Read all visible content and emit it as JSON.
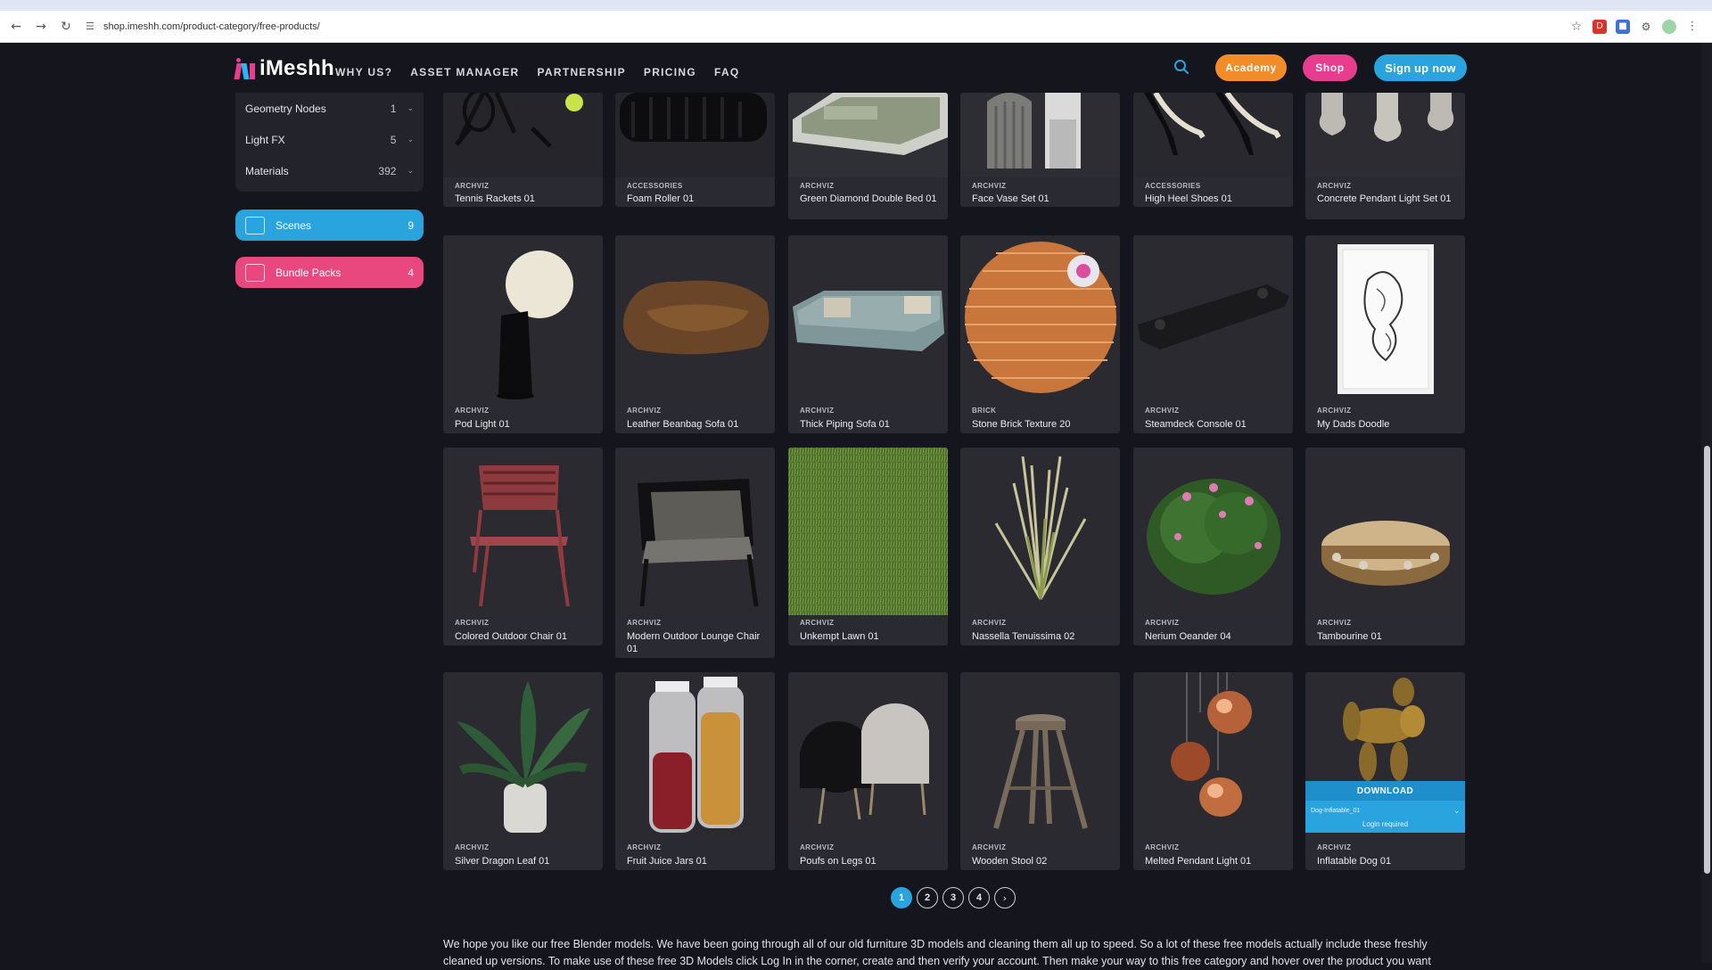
{
  "browser": {
    "url": "shop.imeshh.com/product-category/free-products/"
  },
  "header": {
    "logo_text": "iMeshh",
    "nav": [
      "WHY US?",
      "ASSET MANAGER",
      "PARTNERSHIP",
      "PRICING",
      "FAQ"
    ],
    "academy_label": "Academy",
    "shop_label": "Shop",
    "signup_label": "Sign up now"
  },
  "sidebar": {
    "categories": [
      {
        "label": "Geometry Nodes",
        "count": "1"
      },
      {
        "label": "Light FX",
        "count": "5"
      },
      {
        "label": "Materials",
        "count": "392"
      }
    ],
    "scenes": {
      "label": "Scenes",
      "count": "9"
    },
    "bundles": {
      "label": "Bundle Packs",
      "count": "4"
    }
  },
  "products": [
    {
      "cat": "ARCHVIZ",
      "name": "Tennis Rackets 01"
    },
    {
      "cat": "ACCESSORIES",
      "name": "Foam Roller 01"
    },
    {
      "cat": "ARCHVIZ",
      "name": "Green Diamond Double Bed 01"
    },
    {
      "cat": "ARCHVIZ",
      "name": "Face Vase Set 01"
    },
    {
      "cat": "ACCESSORIES",
      "name": "High Heel Shoes 01"
    },
    {
      "cat": "ARCHVIZ",
      "name": "Concrete Pendant Light Set 01"
    },
    {
      "cat": "ARCHVIZ",
      "name": "Pod Light 01"
    },
    {
      "cat": "ARCHVIZ",
      "name": "Leather Beanbag Sofa 01"
    },
    {
      "cat": "ARCHVIZ",
      "name": "Thick Piping Sofa 01"
    },
    {
      "cat": "BRICK",
      "name": "Stone Brick Texture 20"
    },
    {
      "cat": "ARCHVIZ",
      "name": "Steamdeck Console 01"
    },
    {
      "cat": "ARCHVIZ",
      "name": "My Dads Doodle"
    },
    {
      "cat": "ARCHVIZ",
      "name": "Colored Outdoor Chair 01"
    },
    {
      "cat": "ARCHVIZ",
      "name": "Modern Outdoor Lounge Chair 01"
    },
    {
      "cat": "ARCHVIZ",
      "name": "Unkempt Lawn 01"
    },
    {
      "cat": "ARCHVIZ",
      "name": "Nassella Tenuissima 02"
    },
    {
      "cat": "ARCHVIZ",
      "name": "Nerium Oeander 04"
    },
    {
      "cat": "ARCHVIZ",
      "name": "Tambourine 01"
    },
    {
      "cat": "ARCHVIZ",
      "name": "Silver Dragon Leaf 01"
    },
    {
      "cat": "ARCHVIZ",
      "name": "Fruit Juice Jars 01"
    },
    {
      "cat": "ARCHVIZ",
      "name": "Poufs on Legs 01"
    },
    {
      "cat": "ARCHVIZ",
      "name": "Wooden Stool 02"
    },
    {
      "cat": "ARCHVIZ",
      "name": "Melted Pendant Light 01"
    },
    {
      "cat": "ARCHVIZ",
      "name": "Inflatable Dog 01"
    }
  ],
  "download": {
    "title": "DOWNLOAD",
    "selected": "Dog-Inflatable_01",
    "note": "Login required"
  },
  "pagination": [
    "1",
    "2",
    "3",
    "4"
  ],
  "description": "We hope you like our free Blender models. We have been going through all of our old furniture 3D models and cleaning them all up to speed. So a lot of these free models actually include these freshly cleaned up versions. To make use of these free 3D Models click Log In in the corner, create and then verify your account. Then make your way to this free category and hover over the product you want",
  "colors": {
    "accent_blue": "#2aa4df",
    "accent_pink": "#e83c8f",
    "accent_orange": "#f28c28",
    "background": "#15151d"
  }
}
